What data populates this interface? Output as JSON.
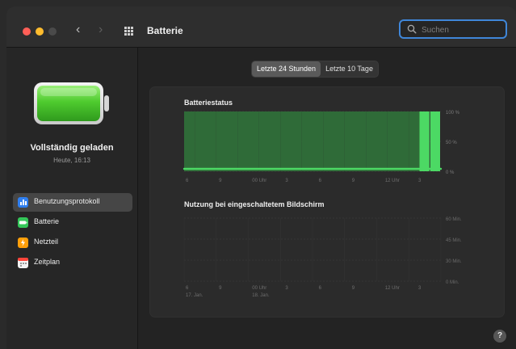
{
  "window": {
    "title": "Batterie"
  },
  "search": {
    "placeholder": "Suchen",
    "value": ""
  },
  "sidebar": {
    "status_title": "Vollständig geladen",
    "status_time": "Heute, 16:13",
    "items": [
      {
        "label": "Benutzungsprotokoll",
        "icon": "bar-chart-icon",
        "color": "#2f7ff0",
        "active": true
      },
      {
        "label": "Batterie",
        "icon": "battery-icon",
        "color": "#34c759",
        "active": false
      },
      {
        "label": "Netzteil",
        "icon": "power-adapter-icon",
        "color": "#ff9f0a",
        "active": false
      },
      {
        "label": "Zeitplan",
        "icon": "calendar-icon",
        "color": "#ff453a",
        "active": false
      }
    ]
  },
  "range_tabs": [
    {
      "label": "Letzte 24 Stunden",
      "active": true
    },
    {
      "label": "Letzte 10 Tage",
      "active": false
    }
  ],
  "chart_data": [
    {
      "type": "area",
      "title": "Batteriestatus",
      "x": [
        "6",
        "9",
        "00 Uhr",
        "3",
        "6",
        "9",
        "12 Uhr",
        "3"
      ],
      "y_ticks": [
        "100 %",
        "50 %",
        "0 %"
      ],
      "ylim": [
        0,
        100
      ],
      "series": [
        {
          "values": [
            100,
            100,
            100,
            100,
            100,
            100,
            100,
            100,
            100,
            100,
            100,
            100,
            100,
            100,
            100,
            100,
            100,
            100,
            100,
            100,
            100,
            100,
            100,
            100
          ]
        }
      ],
      "highlight_start_index": 22,
      "colors": {
        "fill": "#2f6b38",
        "highlight": "#4cd964",
        "charging_line": "#4cd964"
      }
    },
    {
      "type": "bar",
      "title": "Nutzung bei eingeschaltetem Bildschirm",
      "x": [
        "6",
        "9",
        "00 Uhr",
        "3",
        "6",
        "9",
        "12 Uhr",
        "3"
      ],
      "date_labels": [
        "17. Jan.",
        "18. Jan."
      ],
      "y_ticks": [
        "60 Min.",
        "45 Min.",
        "30 Min.",
        "0 Min."
      ],
      "ylim": [
        0,
        60
      ],
      "series": [
        {
          "values": [
            0,
            0,
            0,
            0,
            0,
            0,
            0,
            0,
            0,
            0,
            0,
            0,
            0,
            0,
            0,
            0,
            0,
            0,
            0,
            0,
            0,
            0,
            0,
            0
          ]
        }
      ]
    }
  ],
  "help": {
    "label": "?"
  }
}
